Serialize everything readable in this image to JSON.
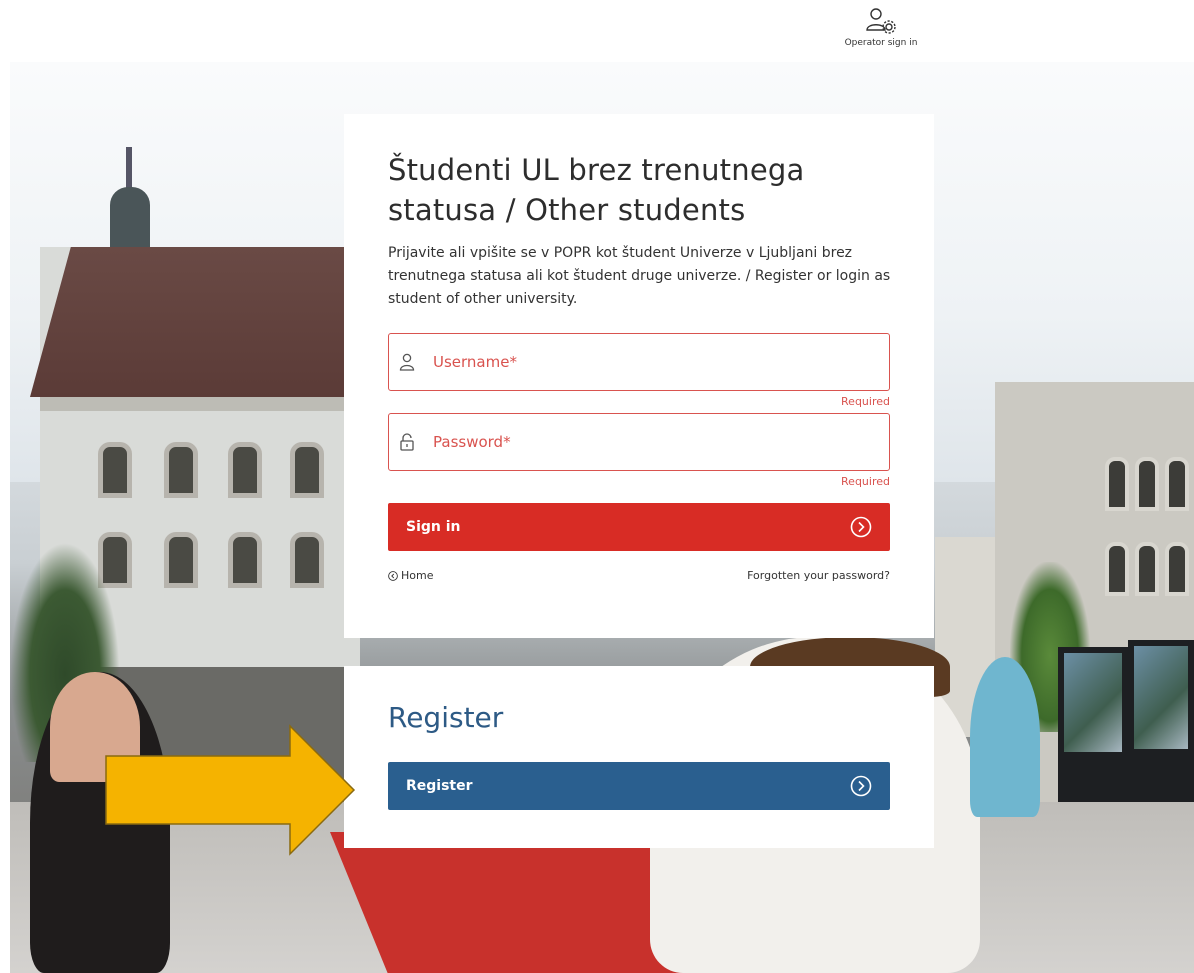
{
  "header": {
    "operator_label": "Operator sign in",
    "operator_icon": "user-gear-icon"
  },
  "login": {
    "title": "Študenti UL brez trenutnega statusa / Other students",
    "description": "Prijavite ali vpišite se v POPR kot študent Univerze v Ljubljani brez trenutnega statusa ali kot študent druge univerze. / Register or login as student of other university.",
    "username": {
      "placeholder": "Username*",
      "value": "",
      "error": "Required",
      "icon": "user-icon"
    },
    "password": {
      "placeholder": "Password*",
      "value": "",
      "error": "Required",
      "icon": "lock-icon"
    },
    "sign_in_label": "Sign in",
    "home_label": "Home",
    "forgot_label": "Forgotten your password?"
  },
  "register": {
    "title": "Register",
    "button_label": "Register"
  },
  "colors": {
    "error": "#d9534f",
    "primary_red": "#d82c25",
    "primary_blue": "#2a5f8f",
    "register_title": "#2d5a85",
    "arrow": "#f5b300"
  }
}
